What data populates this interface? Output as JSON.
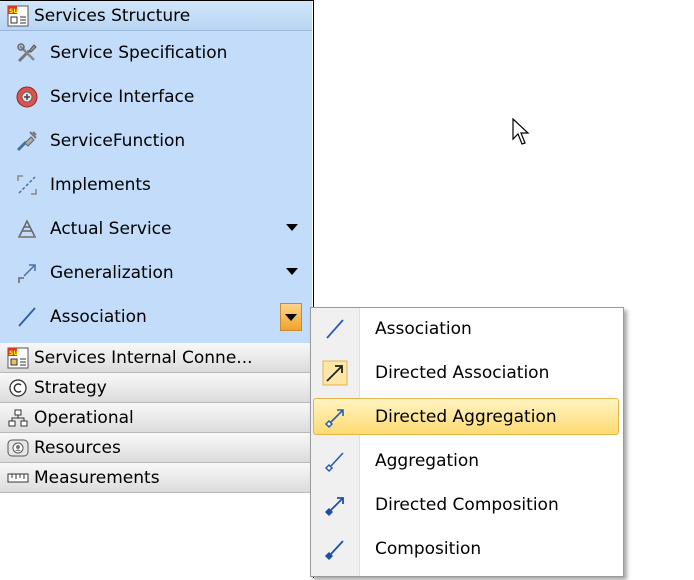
{
  "palette": {
    "open_group": {
      "label": "Services Structure",
      "icon": "services-structure-icon"
    },
    "tools": [
      {
        "label": "Service Specification",
        "icon": "service-specification-icon"
      },
      {
        "label": "Service Interface",
        "icon": "service-interface-icon"
      },
      {
        "label": "ServiceFunction",
        "icon": "service-function-icon"
      },
      {
        "label": "Implements",
        "icon": "implements-icon"
      },
      {
        "label": "Actual Service",
        "icon": "actual-service-icon",
        "has_dropdown": true
      },
      {
        "label": "Generalization",
        "icon": "generalization-icon",
        "has_dropdown": true
      },
      {
        "label": "Association",
        "icon": "association-icon",
        "has_dropdown": true,
        "dropdown_open": true
      }
    ],
    "groups": [
      {
        "label": "Services Internal Conne...",
        "icon": "services-internal-connectivity-icon"
      },
      {
        "label": "Strategy",
        "icon": "strategy-icon"
      },
      {
        "label": "Operational",
        "icon": "operational-icon"
      },
      {
        "label": "Resources",
        "icon": "resources-icon"
      },
      {
        "label": "Measurements",
        "icon": "measurements-icon"
      }
    ]
  },
  "dropdown": {
    "items": [
      {
        "label": "Association",
        "icon": "association-icon"
      },
      {
        "label": "Directed Association",
        "icon": "directed-association-icon"
      },
      {
        "label": "Directed Aggregation",
        "icon": "directed-aggregation-icon",
        "selected": true
      },
      {
        "label": "Aggregation",
        "icon": "aggregation-icon"
      },
      {
        "label": "Directed Composition",
        "icon": "directed-composition-icon"
      },
      {
        "label": "Composition",
        "icon": "composition-icon"
      }
    ]
  },
  "colors": {
    "open_group_background": "#c2dcf9",
    "selection_highlight": "#fddb73",
    "active_arrow_button": "#f2a32b",
    "line_icon_blue": "#2a5db0"
  }
}
